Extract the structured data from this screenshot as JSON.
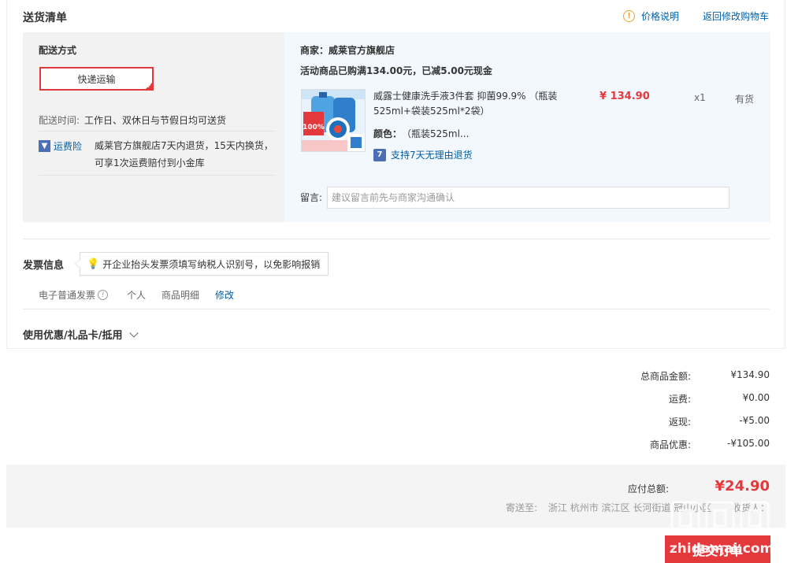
{
  "delivery": {
    "title": "送货清单",
    "price_explain": "价格说明",
    "back_to_cart": "返回修改购物车",
    "method_label": "配送方式",
    "method_value": "快递运输",
    "time_label": "配送时间:",
    "time_value": "工作日、双休日与节假日均可送货",
    "insurance_label": "运费险",
    "insurance_text": "威莱官方旗舰店7天内退货，15天内换货，可享1次运费赔付到小金库"
  },
  "order": {
    "merchant": "商家：威莱官方旗舰店",
    "promo": "活动商品已购满134.00元，已减5.00元现金",
    "product": {
      "title": "威露士健康洗手液3件套 抑菌99.9% （瓶装525ml+袋装525ml*2袋）",
      "price": "¥ 134.90",
      "qty": "x1",
      "stock": "有货",
      "color_label": "颜色：",
      "color_value": "（瓶装525ml...",
      "return_policy": "支持7天无理由退货",
      "img_badge": "100%"
    },
    "message_label": "留言:",
    "message_placeholder": "建议留言前先与商家沟通确认"
  },
  "invoice": {
    "title": "发票信息",
    "tip": "开企业抬头发票须填写纳税人识别号，以免影响报销",
    "type": "电子普通发票",
    "person": "个人",
    "detail": "商品明细",
    "modify": "修改"
  },
  "coupon": {
    "label": "使用优惠/礼品卡/抵用"
  },
  "summary": {
    "rows": [
      {
        "label": "总商品金额:",
        "value": "¥134.90"
      },
      {
        "label": "运费:",
        "value": "¥0.00"
      },
      {
        "label": "返现:",
        "value": "-¥5.00"
      },
      {
        "label": "商品优惠:",
        "value": "-¥105.00"
      }
    ],
    "payable_label": "应付总额:",
    "payable_value": "¥24.90",
    "ship_to_label": "寄送至:",
    "ship_to_value": "浙江 杭州市 滨江区 长河街道 冠山小区",
    "receiver_label": "收货人：",
    "submit": "提交订单"
  },
  "watermark": {
    "site": "zhidemai.com"
  },
  "colors": {
    "accent": "#e4393c",
    "link": "#005ea7",
    "left_panel": "#f2f2f2",
    "right_panel": "#f3f8fe"
  }
}
